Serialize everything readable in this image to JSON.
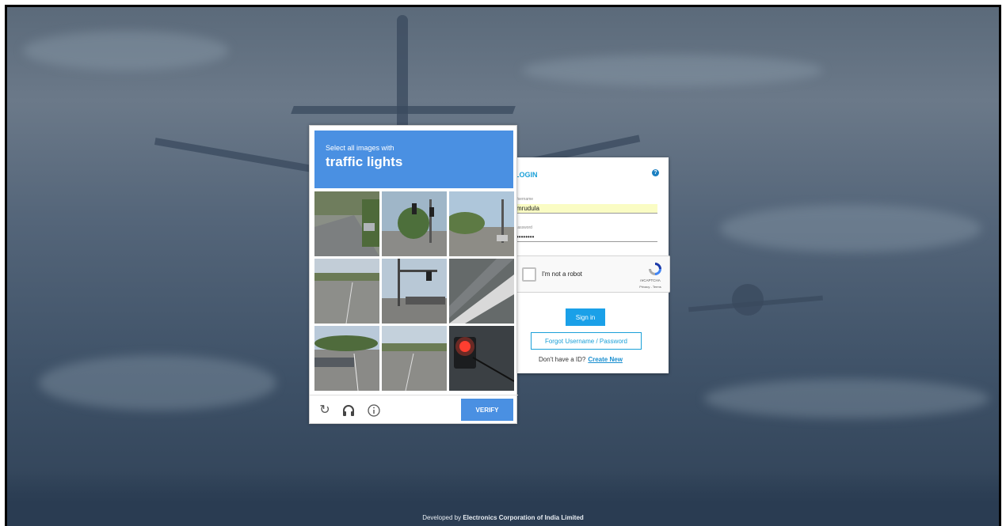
{
  "login": {
    "title": "LOGIN",
    "help_icon": "question-circle-icon",
    "username_label": "Username",
    "username_value": "mrudula",
    "password_label": "Password",
    "password_value": "••••••••",
    "recaptcha_text": "I'm not a robot",
    "recaptcha_brand": "reCAPTCHA",
    "recaptcha_links": "Privacy - Terms",
    "signin_label": "Sign in",
    "forgot_label": "Forgot Username / Password",
    "no_id_text": "Don't have a ID?",
    "create_new_label": "Create New"
  },
  "challenge": {
    "subtitle": "Select all images with",
    "target": "traffic lights",
    "verify_label": "VERIFY",
    "icons": [
      "reload-icon",
      "audio-headphones-icon",
      "info-icon"
    ]
  },
  "footer": {
    "prefix": "Developed by",
    "company": "Electronics Corporation of India Limited"
  },
  "colors": {
    "accent": "#1aa0d8",
    "captcha_blue": "#4a90e2",
    "autofill": "#fafcc4"
  }
}
